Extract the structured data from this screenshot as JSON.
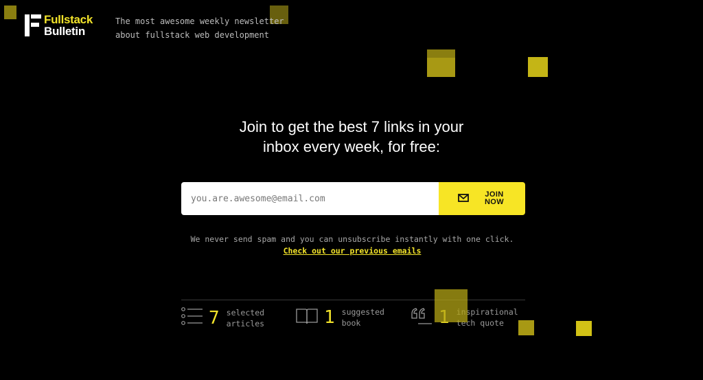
{
  "brand": {
    "name_line1": "Fullstack",
    "name_line2": "Bulletin"
  },
  "tagline": {
    "line1": "The most awesome weekly newsletter",
    "line2": "about fullstack web development"
  },
  "headline": {
    "line1": "Join to get the best 7 links in your",
    "line2": "inbox every week, for free:"
  },
  "signup": {
    "email_placeholder": "you.are.awesome@email.com",
    "join_label_line1": "JOIN",
    "join_label_line2": "NOW",
    "join_icon": "envelope-icon"
  },
  "note": "We never send spam and you can unsubscribe instantly with one click.",
  "previous_link": "Check out our previous emails",
  "stats": [
    {
      "icon": "list-icon",
      "count": "7",
      "label_line1": "selected",
      "label_line2": "articles"
    },
    {
      "icon": "book-icon",
      "count": "1",
      "label_line1": "suggested",
      "label_line2": "book"
    },
    {
      "icon": "quote-icon",
      "count": "1",
      "label_line1": "inspirational",
      "label_line2": "tech quote"
    }
  ],
  "colors": {
    "accent": "#f7e525",
    "background": "#000000"
  }
}
